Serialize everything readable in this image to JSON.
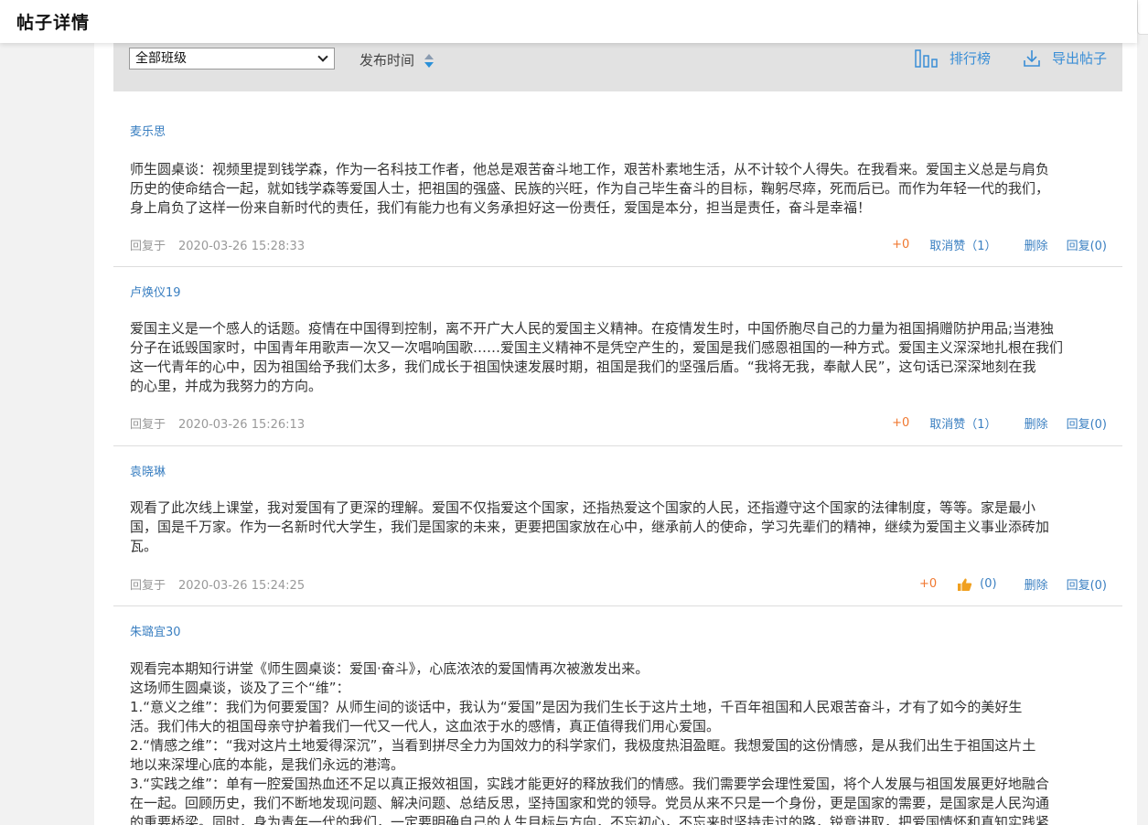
{
  "header": {
    "title": "帖子详情"
  },
  "toolbar": {
    "class_select_value": "全部班级",
    "sort_label": "发布时间",
    "rank_label": "排行榜",
    "export_label": "导出帖子"
  },
  "posts": [
    {
      "author": "麦乐思",
      "lines": [
        "师生圆桌谈：视频里提到钱学森，作为一名科技工作者，他总是艰苦奋斗地工作，艰苦朴素地生活，从不计较个人得失。在我看来。爱国主义总是与肩负",
        "历史的使命结合一起，就如钱学森等爱国人士，把祖国的强盛、民族的兴旺，作为自己毕生奋斗的目标，鞠躬尽瘁，死而后已。而作为年轻一代的我们，",
        "身上肩负了这样一份来自新时代的责任，我们有能力也有义务承担好这一份责任，爱国是本分，担当是责任，奋斗是幸福！"
      ],
      "reply_prefix": "回复于",
      "time": "2020-03-26 15:28:33",
      "plus": "+0",
      "like_label": "取消赞（1）",
      "delete_label": "删除",
      "reply_label": "回复(0)"
    },
    {
      "author": "卢焕仪19",
      "lines": [
        "爱国主义是一个感人的话题。疫情在中国得到控制，离不开广大人民的爱国主义精神。在疫情发生时，中国侨胞尽自己的力量为祖国捐赠防护用品;当港独",
        "分子在诋毁国家时，中国青年用歌声一次又一次唱响国歌……爱国主义精神不是凭空产生的，爱国是我们感恩祖国的一种方式。爱国主义深深地扎根在我们",
        "这一代青年的心中，因为祖国给予我们太多，我们成长于祖国快速发展时期，祖国是我们的坚强后盾。“我将无我，奉献人民”，这句话已深深地刻在我",
        "的心里，并成为我努力的方向。"
      ],
      "reply_prefix": "回复于",
      "time": "2020-03-26 15:26:13",
      "plus": "+0",
      "like_label": "取消赞（1）",
      "delete_label": "删除",
      "reply_label": "回复(0)"
    },
    {
      "author": "袁晓琳",
      "lines": [
        "观看了此次线上课堂，我对爱国有了更深的理解。爱国不仅指爱这个国家，还指热爱这个国家的人民，还指遵守这个国家的法律制度，等等。家是最小",
        "国，国是千万家。作为一名新时代大学生，我们是国家的未来，更要把国家放在心中，继承前人的使命，学习先辈们的精神，继续为爱国主义事业添砖加",
        "瓦。"
      ],
      "reply_prefix": "回复于",
      "time": "2020-03-26 15:24:25",
      "plus": "+0",
      "like_label": "(0)",
      "delete_label": "删除",
      "reply_label": "回复(0)"
    },
    {
      "author": "朱璐宜30",
      "lines": [
        "观看完本期知行讲堂《师生圆桌谈：爱国·奋斗》，心底浓浓的爱国情再次被激发出来。",
        "这场师生圆桌谈，谈及了三个“维”：",
        "1.“意义之维”：我们为何要爱国？从师生间的谈话中，我认为“爱国”是因为我们生长于这片土地，千百年祖国和人民艰苦奋斗，才有了如今的美好生",
        "活。我们伟大的祖国母亲守护着我们一代又一代人，这血浓于水的感情，真正值得我们用心爱国。",
        "2.“情感之维”：“我对这片土地爱得深沉”，当看到拼尽全力为国效力的科学家们，我极度热泪盈眶。我想爱国的这份情感，是从我们出生于祖国这片土",
        "地以来深埋心底的本能，是我们永远的港湾。",
        "3.“实践之维”：单有一腔爱国热血还不足以真正报效祖国，实践才能更好的释放我们的情感。我们需要学会理性爱国，将个人发展与祖国发展更好地融合",
        "在一起。回顾历史，我们不断地发现问题、解决问题、总结反思，坚持国家和党的领导。党员从来不只是一个身份，更是国家的需要，是国家是人民沟通",
        "的重要桥梁。同时，身为青年一代的我们，一定要明确自己的人生目标与方向，不忘初心，不忘来时坚持走过的路，锐意进取，把爱国情怀和真知实践紧"
      ]
    }
  ]
}
